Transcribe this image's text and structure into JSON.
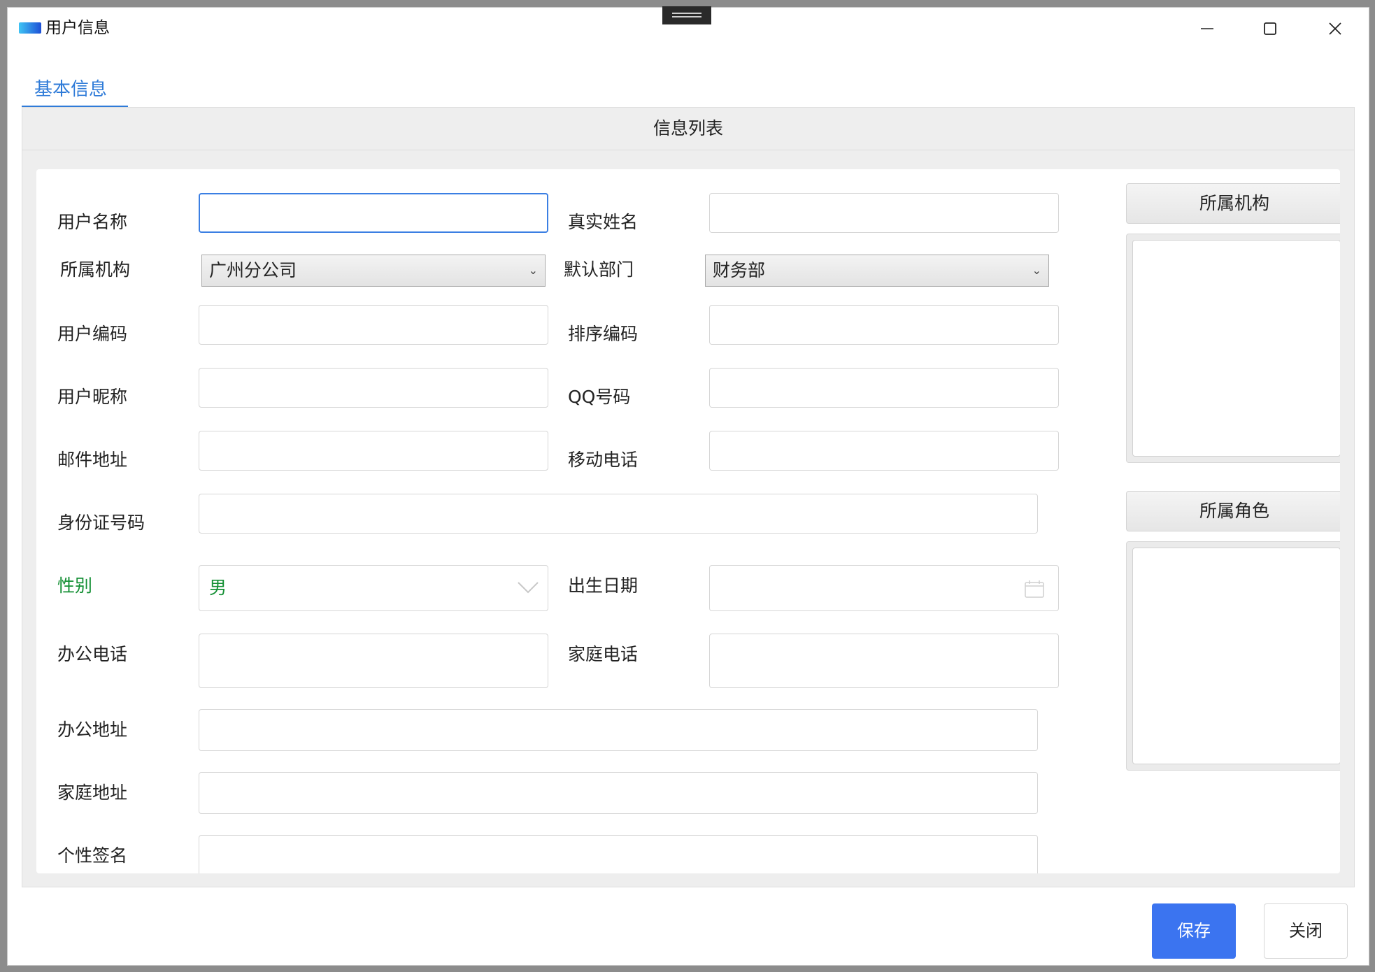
{
  "window": {
    "title": "用户信息",
    "controls": {
      "minimize": "minimize-icon",
      "maximize": "maximize-icon",
      "close": "close-icon"
    }
  },
  "tabs": [
    {
      "label": "基本信息",
      "active": true
    }
  ],
  "panel": {
    "title": "信息列表"
  },
  "form": {
    "username": {
      "label": "用户名称",
      "value": ""
    },
    "realname": {
      "label": "真实姓名",
      "value": ""
    },
    "org": {
      "label": "所属机构",
      "selected": "广州分公司"
    },
    "dept": {
      "label": "默认部门",
      "selected": "财务部"
    },
    "usercode": {
      "label": "用户编码",
      "value": ""
    },
    "sortcode": {
      "label": "排序编码",
      "value": ""
    },
    "nickname": {
      "label": "用户昵称",
      "value": ""
    },
    "qq": {
      "label": "QQ号码",
      "value": ""
    },
    "email": {
      "label": "邮件地址",
      "value": ""
    },
    "mobile": {
      "label": "移动电话",
      "value": ""
    },
    "idcard": {
      "label": "身份证号码",
      "value": ""
    },
    "gender": {
      "label": "性别",
      "selected": "男"
    },
    "birthday": {
      "label": "出生日期",
      "value": ""
    },
    "officephone": {
      "label": "办公电话",
      "value": ""
    },
    "homephone": {
      "label": "家庭电话",
      "value": ""
    },
    "officeaddr": {
      "label": "办公地址",
      "value": ""
    },
    "homeaddr": {
      "label": "家庭地址",
      "value": ""
    },
    "signature": {
      "label": "个性签名",
      "value": ""
    }
  },
  "side": {
    "orgs_title": "所属机构",
    "roles_title": "所属角色"
  },
  "buttons": {
    "save": "保存",
    "close": "关闭"
  },
  "colors": {
    "accent": "#2f7bd8",
    "save_button": "#3b74f0",
    "required_label": "#159035"
  }
}
